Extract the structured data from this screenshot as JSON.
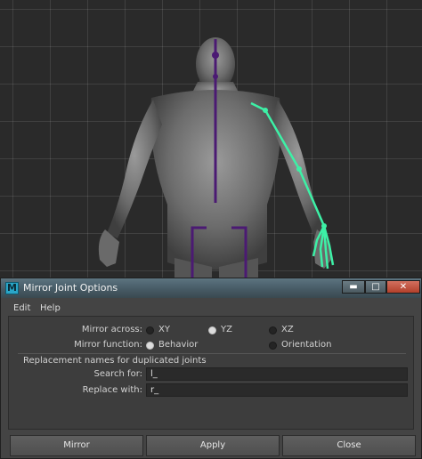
{
  "dialog": {
    "title": "Mirror Joint Options",
    "app_icon": "maya-m-icon",
    "app_icon_letter": "M",
    "window_controls": {
      "minimize": "▬",
      "maximize": "□",
      "close": "✕"
    }
  },
  "menu": {
    "edit": "Edit",
    "help": "Help"
  },
  "mirror_across": {
    "label": "Mirror across:",
    "options": [
      "XY",
      "YZ",
      "XZ"
    ],
    "selected": "YZ"
  },
  "mirror_function": {
    "label": "Mirror function:",
    "options": [
      "Behavior",
      "Orientation"
    ],
    "selected": "Behavior"
  },
  "replacement": {
    "heading": "Replacement names for duplicated joints",
    "search_label": "Search for:",
    "search_value": "l_",
    "replace_label": "Replace with:",
    "replace_value": "r_"
  },
  "buttons": {
    "mirror": "Mirror",
    "apply": "Apply",
    "close": "Close"
  },
  "colors": {
    "skeleton_spine": "#4b1a73",
    "selected_joints": "#3df0a6",
    "viewport_bg": "#2a2a2a"
  }
}
